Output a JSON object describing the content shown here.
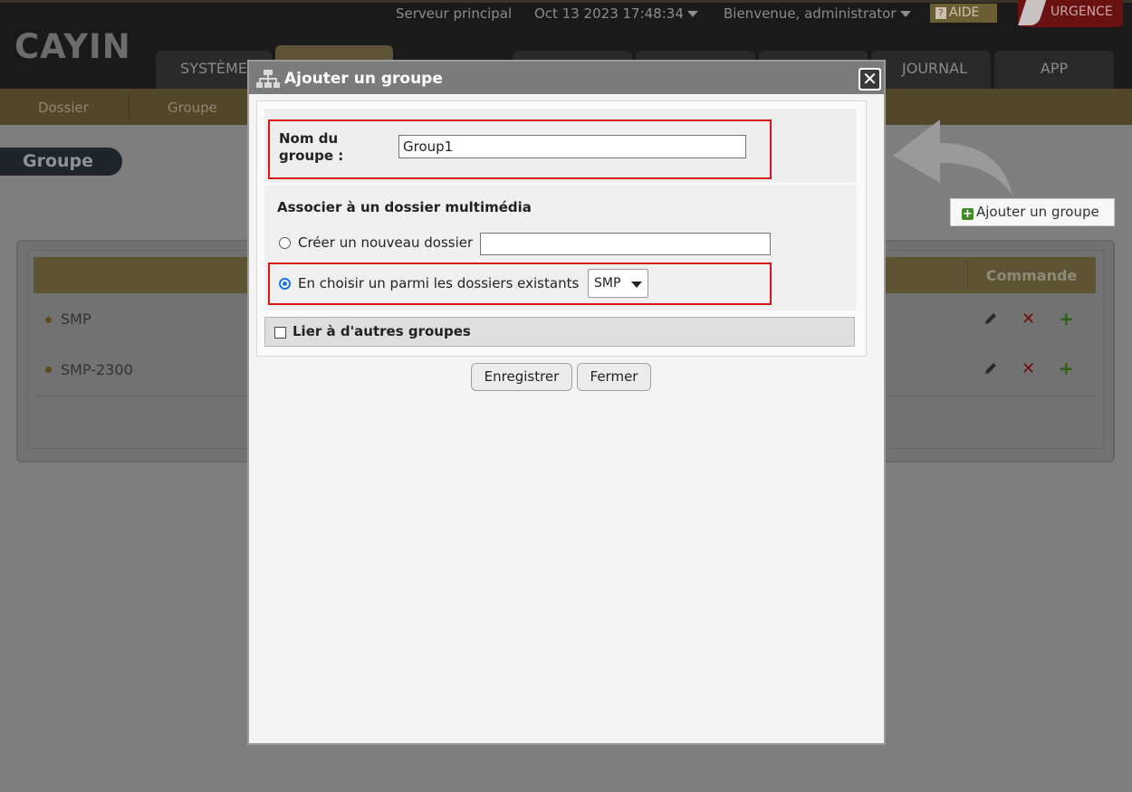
{
  "header": {
    "server": "Serveur principal",
    "datetime": "Oct 13 2023 17:48:34",
    "welcome": "Bienvenue, administrator",
    "help": "AIDE",
    "urgency": "URGENCE",
    "logo": "CAYIN"
  },
  "nav": {
    "tabs": [
      "SYSTÈME",
      "JOURNAL",
      "APP"
    ]
  },
  "subnav": {
    "items": [
      "Dossier",
      "Groupe"
    ]
  },
  "page": {
    "title": "Groupe",
    "add_button": "Ajouter un groupe",
    "table": {
      "command_header": "Commande",
      "rows": [
        "SMP",
        "SMP-2300"
      ]
    }
  },
  "modal": {
    "title": "Ajouter un groupe",
    "close": "✕",
    "group_name_label": "Nom du groupe :",
    "group_name_value": "Group1",
    "associate_title": "Associer à un dossier multimédia",
    "option_new": "Créer un nouveau dossier",
    "option_existing": "En choisir un parmi les dossiers existants",
    "folder_select": "SMP",
    "link_label": "Lier à d'autres groupes",
    "save": "Enregistrer",
    "close_button": "Fermer"
  },
  "colors": {
    "accent_gold": "#524729",
    "highlight_red": "#d9141a",
    "radio_blue": "#1a73e8",
    "plus_green": "#3f8a24"
  }
}
